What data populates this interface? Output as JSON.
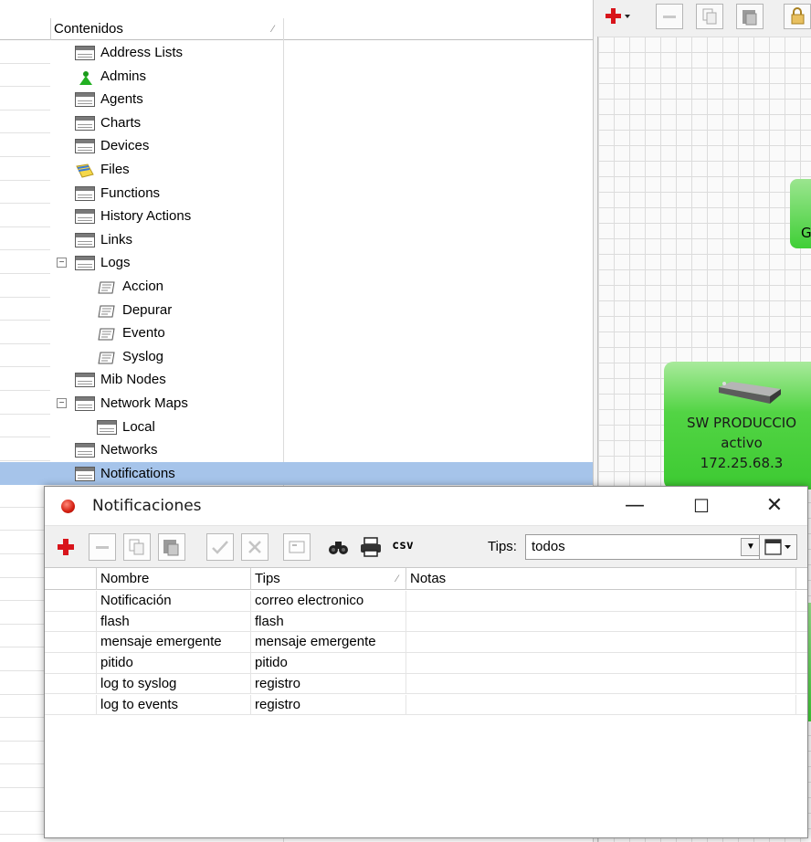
{
  "tree": {
    "header_label": "Contenidos",
    "items": [
      {
        "label": "Address Lists",
        "icon": "table-icon"
      },
      {
        "label": "Admins",
        "icon": "admin-user-icon"
      },
      {
        "label": "Agents",
        "icon": "table-icon"
      },
      {
        "label": "Charts",
        "icon": "table-icon"
      },
      {
        "label": "Devices",
        "icon": "table-icon"
      },
      {
        "label": "Files",
        "icon": "files-icon"
      },
      {
        "label": "Functions",
        "icon": "table-icon"
      },
      {
        "label": "History Actions",
        "icon": "table-icon"
      },
      {
        "label": "Links",
        "icon": "table-icon"
      },
      {
        "label": "Logs",
        "icon": "table-icon",
        "expander": "⊟"
      },
      {
        "label": "Accion",
        "icon": "log-icon"
      },
      {
        "label": "Depurar",
        "icon": "log-icon"
      },
      {
        "label": "Evento",
        "icon": "log-icon"
      },
      {
        "label": "Syslog",
        "icon": "log-icon"
      },
      {
        "label": "Mib Nodes",
        "icon": "table-icon"
      },
      {
        "label": "Network Maps",
        "icon": "table-icon",
        "expander": "⊟"
      },
      {
        "label": "Local",
        "icon": "table-icon"
      },
      {
        "label": "Networks",
        "icon": "table-icon"
      },
      {
        "label": "Notifications",
        "icon": "table-icon",
        "selected": true
      }
    ]
  },
  "map": {
    "partial_label": "G",
    "node": {
      "name": "SW PRODUCCIO",
      "status": "activo",
      "ip": "172.25.68.3"
    },
    "node_color": "#4cd23f"
  },
  "dialog": {
    "title": "Notificaciones",
    "minimize": "—",
    "maximize": "☐",
    "close": "✕",
    "toolbar": {
      "add": "+",
      "remove": "−",
      "csv": "csv",
      "tips_label": "Tips:",
      "tips_value": "todos"
    },
    "columns": [
      "Nombre",
      "Tips",
      "Notas"
    ],
    "rows": [
      {
        "nombre": "Notificación",
        "tips": "correo electronico",
        "notas": ""
      },
      {
        "nombre": "flash",
        "tips": "flash",
        "notas": ""
      },
      {
        "nombre": "mensaje emergente",
        "tips": "mensaje emergente",
        "notas": ""
      },
      {
        "nombre": "pitido",
        "tips": "pitido",
        "notas": ""
      },
      {
        "nombre": "log to syslog",
        "tips": "registro",
        "notas": ""
      },
      {
        "nombre": "log to events",
        "tips": "registro",
        "notas": ""
      }
    ]
  },
  "colors": {
    "selection": "#a6c4ea",
    "add_red": "#d8141b",
    "node_green": "#3fcf36"
  }
}
